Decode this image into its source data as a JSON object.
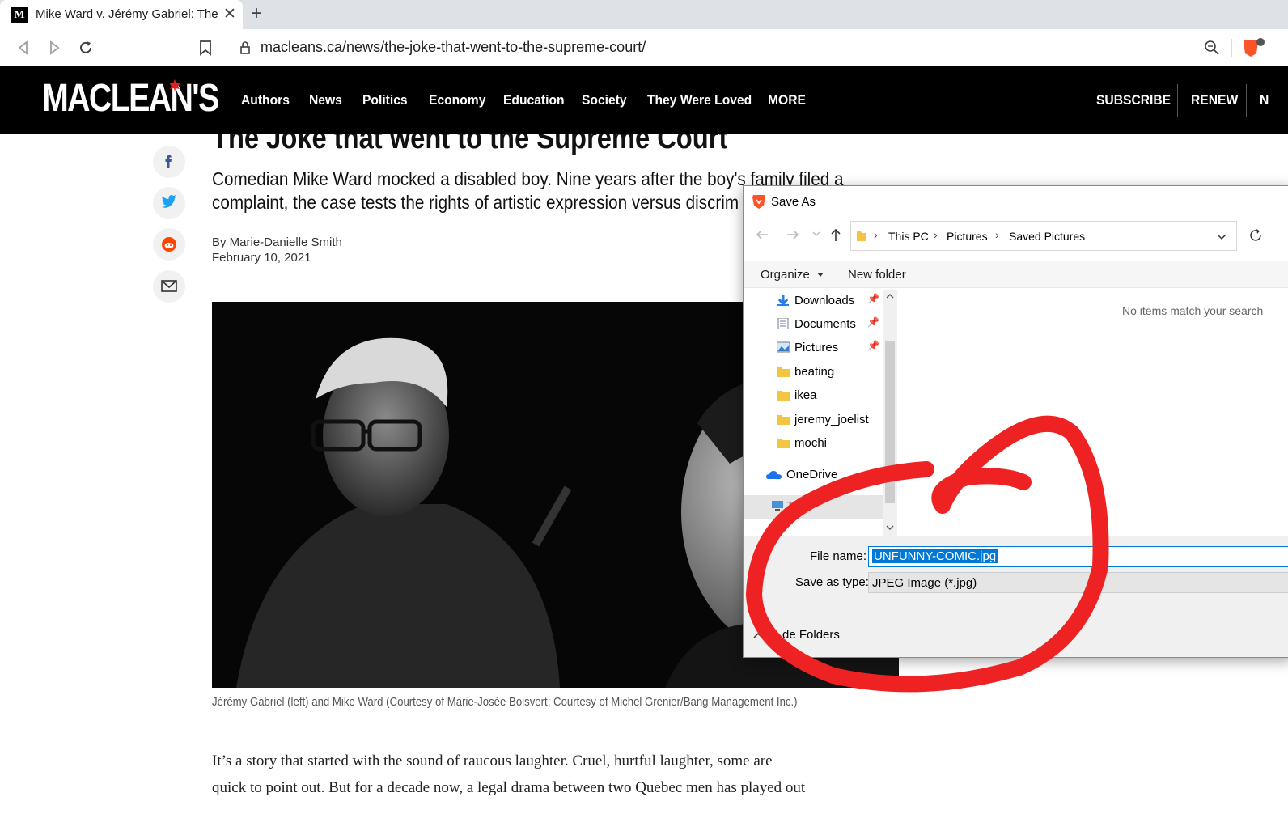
{
  "browser": {
    "tab_title": "Mike Ward v. Jérémy Gabriel: The",
    "tab_favicon": "M",
    "new_tab": "+",
    "close": "✕",
    "url": "macleans.ca/news/the-joke-that-went-to-the-supreme-court/"
  },
  "site": {
    "logo": "MACLEAN'S",
    "nav": [
      "Authors",
      "News",
      "Politics",
      "Economy",
      "Education",
      "Society",
      "They Were Loved",
      "MORE"
    ],
    "right_nav": [
      "SUBSCRIBE",
      "RENEW",
      "N"
    ]
  },
  "article": {
    "headline": "The Joke that went to the Supreme Court",
    "dek": "Comedian Mike Ward mocked a disabled boy. Nine years after the boy's family filed a complaint, the case tests the rights of artistic expression versus discrim",
    "author": "By Marie-Danielle Smith",
    "date": "February 10, 2021",
    "caption": "Jérémy Gabriel (left) and Mike Ward (Courtesy of Marie-Josée Boisvert; Courtesy of Michel Grenier/Bang Management Inc.)",
    "body_line1": "It’s a story that started with the sound of raucous laughter. Cruel, hurtful laughter, some are",
    "body_line2": "quick to point out. But for a decade now, a legal drama between two Quebec men has played out"
  },
  "share_icons": [
    "facebook-icon",
    "twitter-icon",
    "reddit-icon",
    "email-icon"
  ],
  "dialog": {
    "title": "Save As",
    "breadcrumbs": [
      "This PC",
      "Pictures",
      "Saved Pictures"
    ],
    "organize": "Organize",
    "new_folder": "New folder",
    "tree": [
      {
        "label": "Downloads",
        "icon": "download-arrow-icon",
        "pinned": true
      },
      {
        "label": "Documents",
        "icon": "documents-icon",
        "pinned": true
      },
      {
        "label": "Pictures",
        "icon": "pictures-icon",
        "pinned": true
      },
      {
        "label": "beating",
        "icon": "folder-icon",
        "pinned": false
      },
      {
        "label": "ikea",
        "icon": "folder-icon",
        "pinned": false
      },
      {
        "label": "jeremy_joelist",
        "icon": "folder-icon",
        "pinned": false
      },
      {
        "label": "mochi",
        "icon": "folder-icon",
        "pinned": false
      },
      {
        "label": "OneDrive",
        "icon": "onedrive-icon",
        "pinned": false
      },
      {
        "label": "Thi",
        "icon": "this-pc-icon",
        "pinned": false
      }
    ],
    "no_items": "No items match your search",
    "file_name_label": "File name:",
    "file_name_value": "UNFUNNY-COMIC.jpg",
    "save_type_label": "Save as type:",
    "save_type_value": "JPEG Image (*.jpg)",
    "hide_folders": "de Folders"
  },
  "colors": {
    "selection_blue": "#0078d7",
    "annotation_red": "#ee2222",
    "brave_orange": "#fb542b"
  }
}
